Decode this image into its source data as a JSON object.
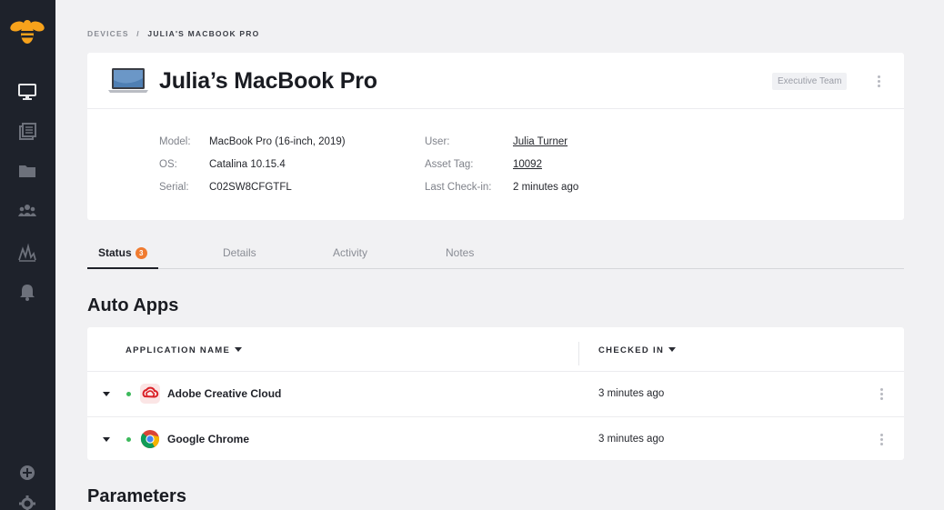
{
  "sidebar": {
    "icons": [
      "bee-logo-icon",
      "monitor-icon",
      "list-icon",
      "folder-icon",
      "users-icon",
      "activity-icon",
      "bell-icon",
      "add-circle-icon",
      "gear-icon"
    ]
  },
  "breadcrumb": {
    "root": "DEVICES",
    "separator": "/",
    "current": "JULIA'S MACBOOK PRO"
  },
  "device": {
    "title": "Julia’s MacBook Pro",
    "badge": "Executive Team",
    "fields": {
      "model_label": "Model:",
      "model_value": "MacBook Pro (16-inch, 2019)",
      "os_label": "OS:",
      "os_value": "Catalina 10.15.4",
      "serial_label": "Serial:",
      "serial_value": "C02SW8CFGTFL",
      "user_label": "User:",
      "user_value": "Julia Turner",
      "asset_label": "Asset Tag:",
      "asset_value": "10092",
      "checkin_label": "Last Check-in:",
      "checkin_value": "2 minutes ago"
    }
  },
  "tabs": {
    "status": "Status",
    "status_count": "3",
    "details": "Details",
    "activity": "Activity",
    "notes": "Notes"
  },
  "auto_apps": {
    "title": "Auto Apps",
    "columns": {
      "name": "APPLICATION NAME",
      "checked": "CHECKED IN"
    },
    "rows": [
      {
        "name": "Adobe Creative Cloud",
        "checked": "3 minutes ago",
        "icon": "adobe-creative-cloud-icon",
        "status_color": "#3cb95b"
      },
      {
        "name": "Google Chrome",
        "checked": "3 minutes ago",
        "icon": "google-chrome-icon",
        "status_color": "#3cb95b"
      }
    ]
  },
  "parameters": {
    "title": "Parameters"
  },
  "colors": {
    "sidebar": "#1e222b",
    "accent_orange": "#f07b30",
    "status_green": "#3cb95b"
  }
}
